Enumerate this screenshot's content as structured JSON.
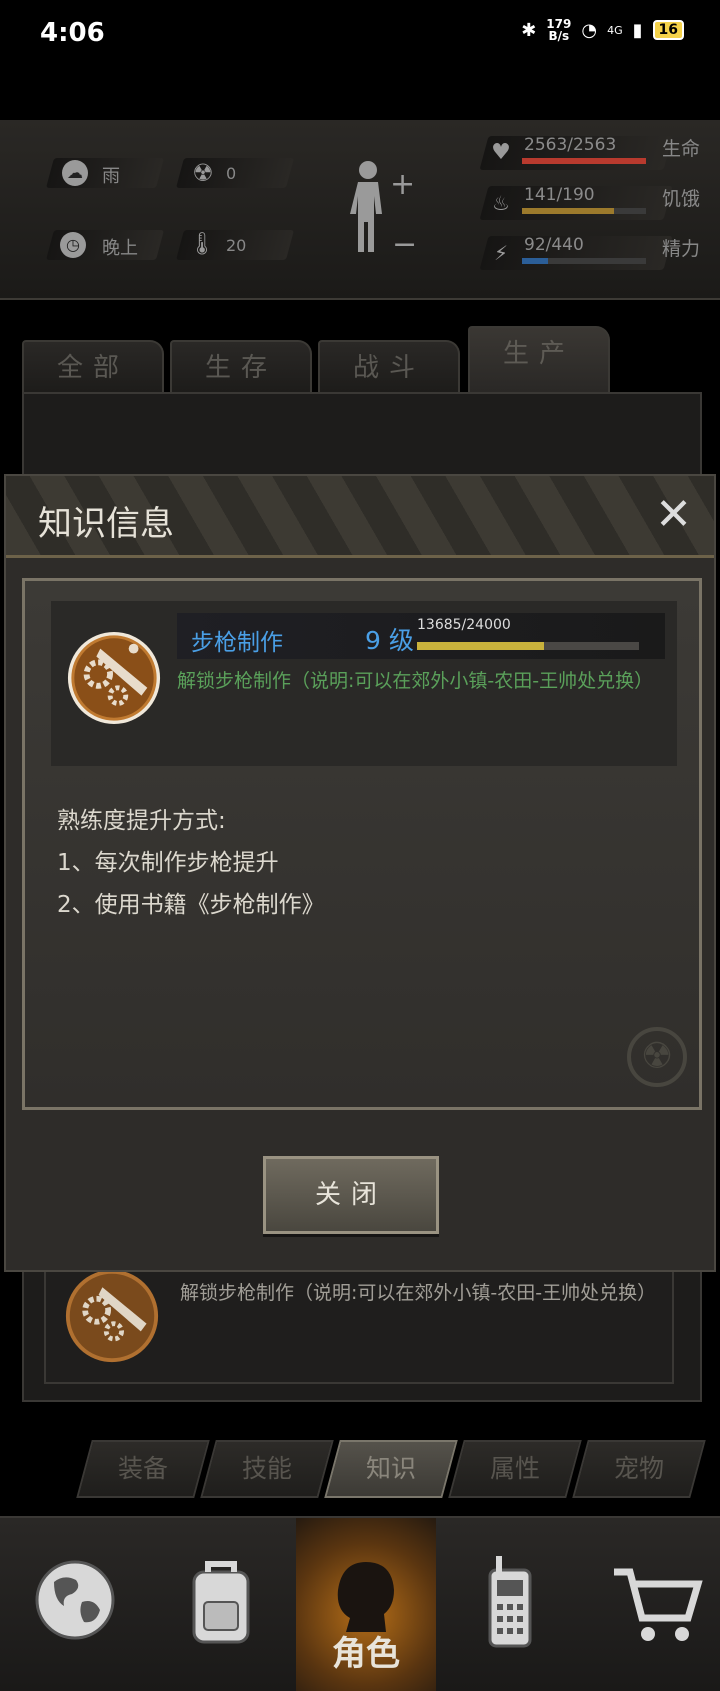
{
  "status_bar": {
    "time": "4:06",
    "net_speed_value": "179",
    "net_speed_unit": "B/s",
    "network": "4G",
    "battery": "16"
  },
  "hud": {
    "weather": "雨",
    "radiation": "0",
    "time_of_day": "晚上",
    "temperature": "20",
    "stats": [
      {
        "label": "生命",
        "value": "2563/2563",
        "fraction": 1.0,
        "color": "#b83a2e"
      },
      {
        "label": "饥饿",
        "value": "141/190",
        "fraction": 0.74,
        "color": "#9c7a2c"
      },
      {
        "label": "精力",
        "value": "92/440",
        "fraction": 0.21,
        "color": "#2b5e98"
      }
    ]
  },
  "tabs": [
    "全部",
    "生存",
    "战斗",
    "生产"
  ],
  "dialog": {
    "title": "知识信息",
    "close_icon": "✕",
    "skill": {
      "name": "步枪制作",
      "level": "9 级",
      "exp": "13685/24000",
      "exp_fraction": 0.57,
      "description": "解锁步枪制作（说明:可以在郊外小镇-农田-王帅处兑换）"
    },
    "method_title": "熟练度提升方式:",
    "methods": [
      "1、每次制作步枪提升",
      "2、使用书籍《步枪制作》"
    ],
    "close_button": "关闭"
  },
  "background_item": {
    "description": "解锁步枪制作（说明:可以在郊外小镇-农田-王帅处兑换）"
  },
  "sub_tabs": [
    "装备",
    "技能",
    "知识",
    "属性",
    "宠物"
  ],
  "bottom_nav": {
    "active_label": "角色",
    "items": [
      "globe-icon",
      "backpack-icon",
      "character-icon",
      "radio-icon",
      "cart-icon"
    ]
  }
}
